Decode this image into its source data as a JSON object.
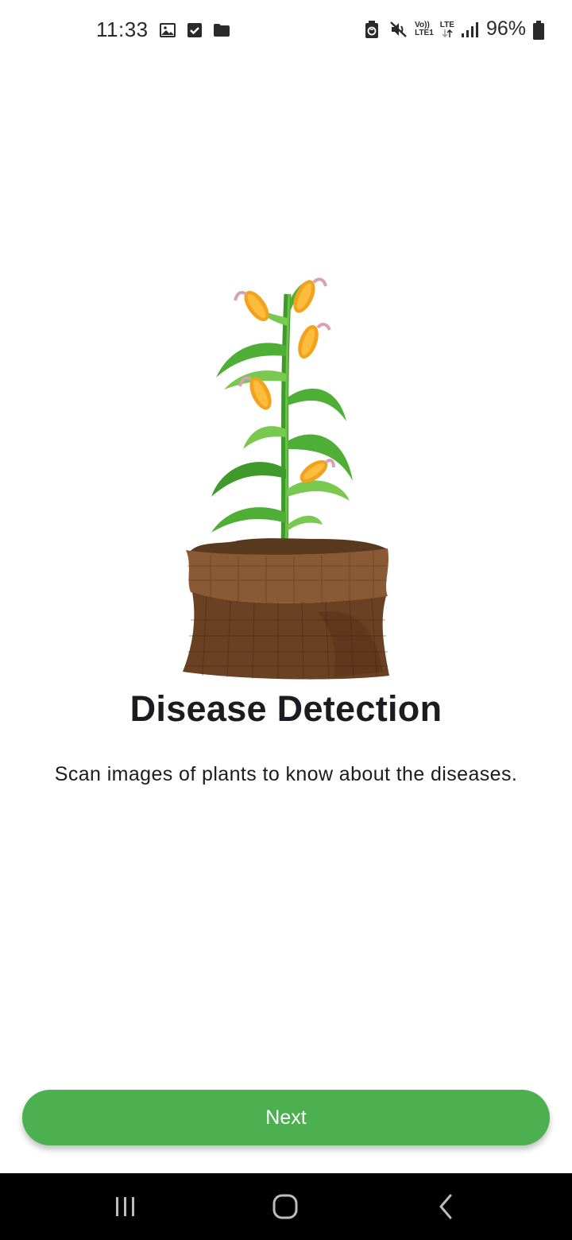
{
  "status_bar": {
    "time": "11:33",
    "notification_icons": [
      "image-icon",
      "checkbox-icon",
      "folder-icon"
    ],
    "system_icons": [
      "battery-saver-icon",
      "mute-icon",
      "volte-icon",
      "lte-icon",
      "signal-icon",
      "battery-icon"
    ],
    "volte_label_top": "Vo))",
    "volte_label_bottom": "LTE1",
    "lte_label": "LTE",
    "battery_percent": "96%"
  },
  "onboarding": {
    "illustration": "corn-plant-in-sack",
    "title": "Disease Detection",
    "description": "Scan images of plants to know about the diseases.",
    "next_label": "Next"
  },
  "colors": {
    "accent": "#4caf50",
    "title_text": "#1c1b20",
    "nav_bar": "#000000"
  },
  "nav_bar": {
    "buttons": [
      "recents-icon",
      "home-icon",
      "back-icon"
    ]
  }
}
